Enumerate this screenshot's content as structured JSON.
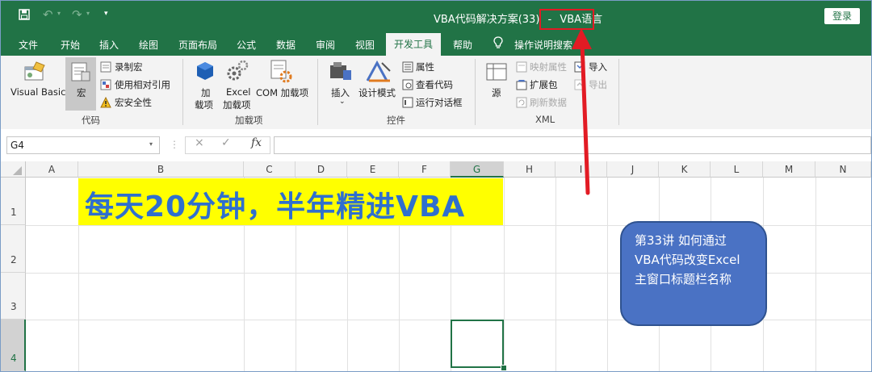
{
  "window": {
    "title": "VBA代码解决方案(33)",
    "separator": "-",
    "app_name": "VBA语言",
    "login_label": "登录"
  },
  "quick_access": {
    "save_icon": "save-icon",
    "undo_icon": "undo-icon",
    "redo_icon": "redo-icon",
    "customize_icon": "customize-qat-icon"
  },
  "tabs": [
    {
      "label": "文件"
    },
    {
      "label": "开始"
    },
    {
      "label": "插入"
    },
    {
      "label": "绘图"
    },
    {
      "label": "页面布局"
    },
    {
      "label": "公式"
    },
    {
      "label": "数据"
    },
    {
      "label": "审阅"
    },
    {
      "label": "视图"
    },
    {
      "label": "开发工具",
      "active": true
    },
    {
      "label": "帮助"
    },
    {
      "label": "操作说明搜索"
    }
  ],
  "ribbon": {
    "code": {
      "group_label": "代码",
      "visual_basic": "Visual Basic",
      "macros": "宏",
      "record_macro": "录制宏",
      "relative_refs": "使用相对引用",
      "macro_security": "宏安全性"
    },
    "addins": {
      "group_label": "加载项",
      "addins_line1": "加",
      "addins_line2": "载项",
      "excel_addins_line1": "Excel",
      "excel_addins_line2": "加载项",
      "com_addins": "COM 加载项"
    },
    "controls": {
      "group_label": "控件",
      "insert": "插入",
      "design_mode": "设计模式",
      "properties": "属性",
      "view_code": "查看代码",
      "run_dialog": "运行对话框"
    },
    "xml": {
      "group_label": "XML",
      "source": "源",
      "map_properties": "映射属性",
      "expansion_packs": "扩展包",
      "refresh_data": "刷新数据",
      "import": "导入",
      "export": "导出"
    }
  },
  "formula_bar": {
    "name_box": "G4",
    "cancel_icon": "×",
    "enter_icon": "✓",
    "fx_label": "fx",
    "formula": ""
  },
  "sheet": {
    "columns": [
      "A",
      "B",
      "C",
      "D",
      "E",
      "F",
      "G",
      "H",
      "I",
      "J",
      "K",
      "L",
      "M",
      "N"
    ],
    "rows": [
      "1",
      "2",
      "3",
      "4"
    ],
    "selected_cell": "G4",
    "banner_text": "每天20分钟，半年精进VBA",
    "banner_color": "#ffff00",
    "banner_text_color": "#2f6fce"
  },
  "callout": {
    "text": "第33讲 如何通过\nVBA代码改变Excel\n主窗口标题栏名称",
    "fill": "#4a72c4"
  },
  "annotation": {
    "arrow_color": "#e21b24"
  },
  "colors": {
    "excel_green": "#217346",
    "ribbon_bg": "#f3f3f3"
  }
}
